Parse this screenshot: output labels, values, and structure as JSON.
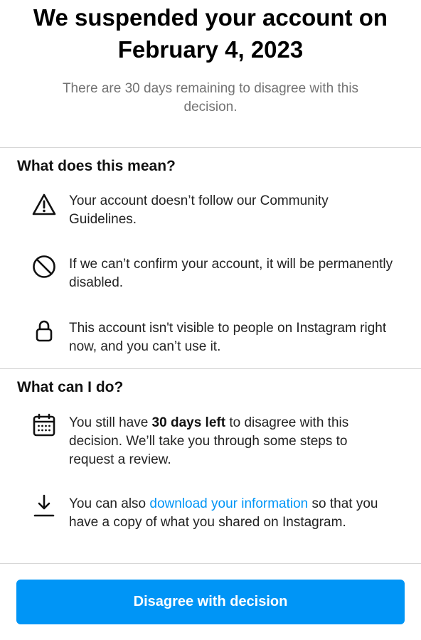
{
  "header": {
    "title_line1": "We suspended your account on",
    "title_line2": "February 4, 2023",
    "subtitle": "There are 30 days remaining to disagree with this decision."
  },
  "meaning": {
    "title": "What does this mean?",
    "items": [
      {
        "icon": "warning-icon",
        "text": "Your account doesn’t follow our Community Guidelines."
      },
      {
        "icon": "prohibited-icon",
        "text": "If we can’t confirm your account, it will be permanently disabled."
      },
      {
        "icon": "lock-icon",
        "text": "This account isn't visible to people on Instagram right now, and you can’t use it."
      }
    ]
  },
  "actions": {
    "title": "What can I do?",
    "items": [
      {
        "icon": "calendar-icon",
        "text_before": "You still have ",
        "text_bold": "30 days left",
        "text_after": " to disagree with this decision. We’ll take you through some steps to request a review."
      },
      {
        "icon": "download-icon",
        "text_before": "You can also ",
        "link_text": "download your information",
        "text_after": " so that you have a copy of what you shared on Instagram."
      }
    ]
  },
  "cta": {
    "label": "Disagree with decision",
    "color": "#0095f6"
  }
}
